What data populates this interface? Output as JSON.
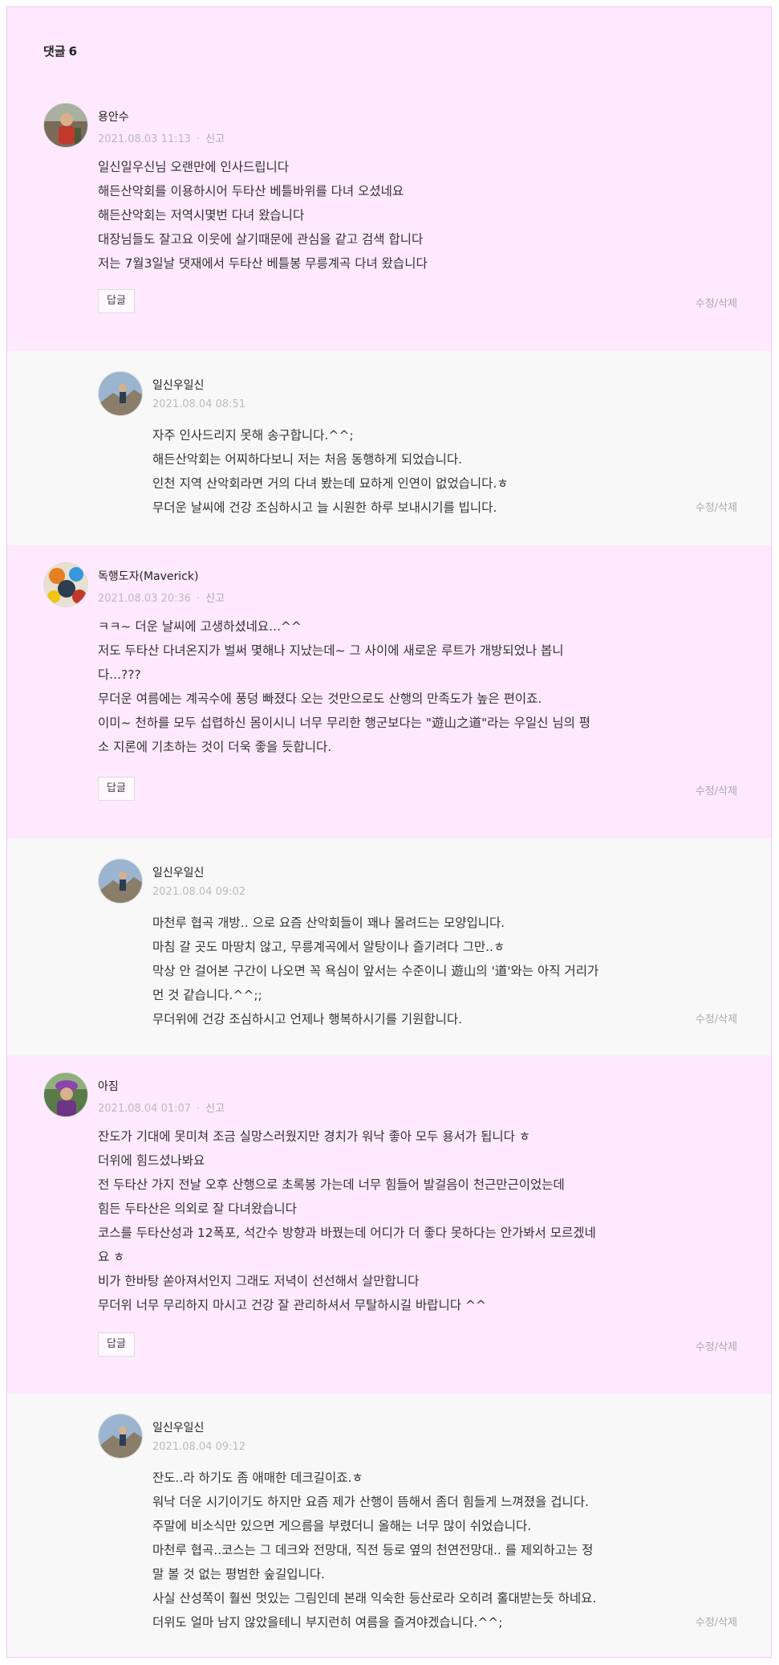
{
  "header": {
    "title": "댓글",
    "count": "6"
  },
  "comments": [
    {
      "author": "용안수",
      "date": "2021.08.03 11:13",
      "report": "신고",
      "lines": [
        "일신일우신님 오랜만에 인사드립니다",
        "해든산악회를 이용하시어 두타산 베틀바위를 다녀 오셨네요",
        "해든산악회는 저역시몇번 다녀 왔습니다",
        "대장님들도 잘고요 이웃에 살기때문에 관심을 같고 검색 합니다",
        "저는 7월3일날 댓재에서 두타산 베틀봉 무릉계곡 다녀 왔습니다"
      ],
      "reply_label": "답글",
      "edit_label": "수정/삭제"
    },
    {
      "author": "일신우일신",
      "date": "2021.08.04 08:51",
      "lines": [
        "자주 인사드리지 못해 송구합니다.^^;",
        "해든산악회는 어찌하다보니 저는 처음 동행하게 되었습니다.",
        "인천 지역 산악회라면 거의 다녀 봤는데 묘하게 인연이 없었습니다.ㅎ",
        "무더운 날씨에 건강 조심하시고 늘 시원한 하루 보내시기를 빕니다."
      ],
      "edit_label": "수정/삭제"
    },
    {
      "author": "독행도자(Maverick)",
      "date": "2021.08.03 20:36",
      "report": "신고",
      "lines": [
        "ㅋㅋ~ 더운 날씨에 고생하셨네요...^^",
        "저도 두타산 다녀온지가 벌써 몇해나 지났는데~ 그 사이에 새로운 루트가 개방되었나 봅니",
        "다...???",
        "무더운 여름에는 계곡수에 풍덩 빠졌다 오는 것만으로도 산행의 만족도가 높은 편이죠.",
        "이미~ 천하를 모두 섭렵하신 몸이시니 너무 무리한 행군보다는 \"遊山之道\"라는 우일신 님의 평",
        "소 지론에 기초하는 것이 더욱 좋을 듯합니다."
      ],
      "reply_label": "답글",
      "edit_label": "수정/삭제"
    },
    {
      "author": "일신우일신",
      "date": "2021.08.04 09:02",
      "lines": [
        "마천루 협곡 개방.. 으로 요즘 산악회들이 꽤나 몰려드는 모양입니다.",
        "마침 갈 곳도 마땅치 않고, 무릉계곡에서 알탕이나 즐기려다 그만..ㅎ",
        "막상 안 걸어본 구간이 나오면 꼭 욕심이 앞서는 수준이니 遊山의 '道'와는 아직 거리가",
        "먼 것 같습니다.^^;;",
        "무더위에 건강 조심하시고 언제나 행복하시기를 기원합니다."
      ],
      "edit_label": "수정/삭제"
    },
    {
      "author": "아짐",
      "date": "2021.08.04 01:07",
      "report": "신고",
      "lines": [
        "잔도가 기대에 못미쳐 조금 실망스러웠지만 경치가 워낙 좋아 모두 용서가 됩니다 ㅎ",
        "더위에 힘드셨나봐요",
        "전 두타산 가지 전날 오후 산행으로 초록봉 가는데 너무 힘들어 발걸음이 천근만근이었는데",
        "힘든 두타산은 의외로 잘 다녀왔습니다",
        "코스를 두타산성과 12폭포, 석간수 방향과 바꿨는데 어디가 더 좋다 못하다는 안가봐서 모르겠네",
        "요 ㅎ",
        "비가 한바탕 쏟아져서인지 그래도 저녁이 선선해서 살만합니다",
        "무더위 너무 무리하지 마시고 건강 잘 관리하셔서 무탈하시길 바랍니다 ^^"
      ],
      "reply_label": "답글",
      "edit_label": "수정/삭제"
    },
    {
      "author": "일신우일신",
      "date": "2021.08.04 09:12",
      "lines": [
        "잔도..라 하기도 좀 애매한 데크길이죠.ㅎ",
        "워낙 더운 시기이기도 하지만 요즘 제가 산행이 뜸해서 좀더 힘들게 느껴졌을 겁니다.",
        "주말에 비소식만 있으면 게으름을 부렸더니 올해는 너무 많이 쉬었습니다.",
        "마천루 협곡..코스는 그 데크와 전망대, 직전 등로 옆의 천연전망대.. 를 제외하고는 정",
        "말 볼 것 없는 평범한 숲길입니다.",
        "사실 산성쪽이 훨씬 멋있는 그림인데 본래 익숙한 등산로라 오히려 홀대받는듯 하네요.",
        "더위도 얼마 남지 않았을테니 부지런히 여름을 즐겨야겠습니다.^^;"
      ],
      "edit_label": "수정/삭제"
    }
  ],
  "avatars": [
    "avatar-person-red",
    "avatar-mountain-climber",
    "avatar-colorful-collage",
    "avatar-mountain-climber",
    "avatar-purple-hat-woman",
    "avatar-mountain-climber"
  ]
}
